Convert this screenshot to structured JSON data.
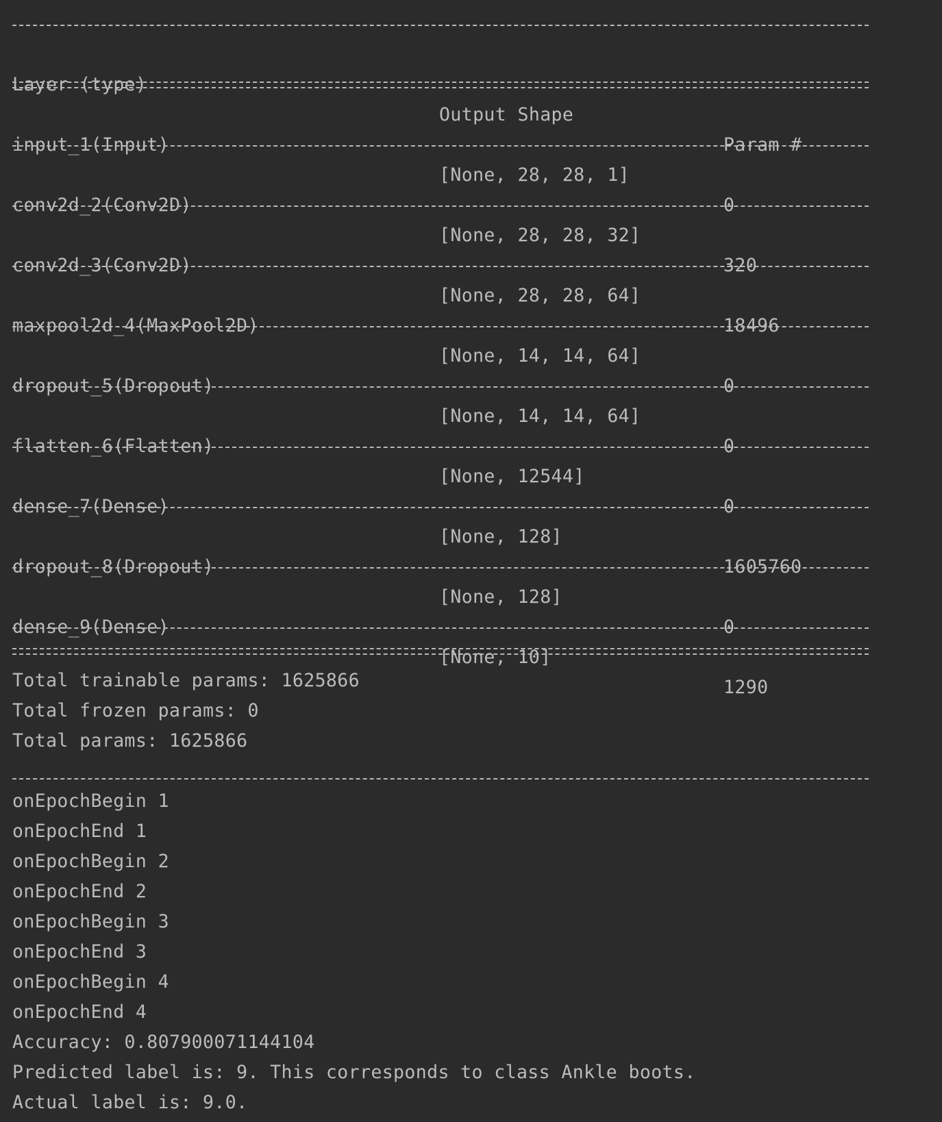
{
  "summary": {
    "headers": {
      "layer": "Layer (type)",
      "output_shape": "Output Shape",
      "params": "Param #"
    },
    "rows": [
      {
        "layer": "input_1(Input)",
        "output_shape": "[None, 28, 28, 1]",
        "params": "0"
      },
      {
        "layer": "conv2d_2(Conv2D)",
        "output_shape": "[None, 28, 28, 32]",
        "params": "320"
      },
      {
        "layer": "conv2d_3(Conv2D)",
        "output_shape": "[None, 28, 28, 64]",
        "params": "18496"
      },
      {
        "layer": "maxpool2d_4(MaxPool2D)",
        "output_shape": "[None, 14, 14, 64]",
        "params": "0"
      },
      {
        "layer": "dropout_5(Dropout)",
        "output_shape": "[None, 14, 14, 64]",
        "params": "0"
      },
      {
        "layer": "flatten_6(Flatten)",
        "output_shape": "[None, 12544]",
        "params": "0"
      },
      {
        "layer": "dense_7(Dense)",
        "output_shape": "[None, 128]",
        "params": "1605760"
      },
      {
        "layer": "dropout_8(Dropout)",
        "output_shape": "[None, 128]",
        "params": "0"
      },
      {
        "layer": "dense_9(Dense)",
        "output_shape": "[None, 10]",
        "params": "1290"
      }
    ],
    "totals": [
      "Total trainable params: 1625866",
      "Total frozen params: 0",
      "Total params: 1625866"
    ]
  },
  "log_lines": [
    "onEpochBegin 1",
    "onEpochEnd 1",
    "onEpochBegin 2",
    "onEpochEnd 2",
    "onEpochBegin 3",
    "onEpochEnd 3",
    "onEpochBegin 4",
    "onEpochEnd 4",
    "Accuracy: 0.807900071144104",
    "Predicted label is: 9. This corresponds to class Ankle boots.",
    "Actual label is: 9.0."
  ],
  "colors": {
    "background": "#2b2b2b",
    "text": "#bbbbbb"
  }
}
